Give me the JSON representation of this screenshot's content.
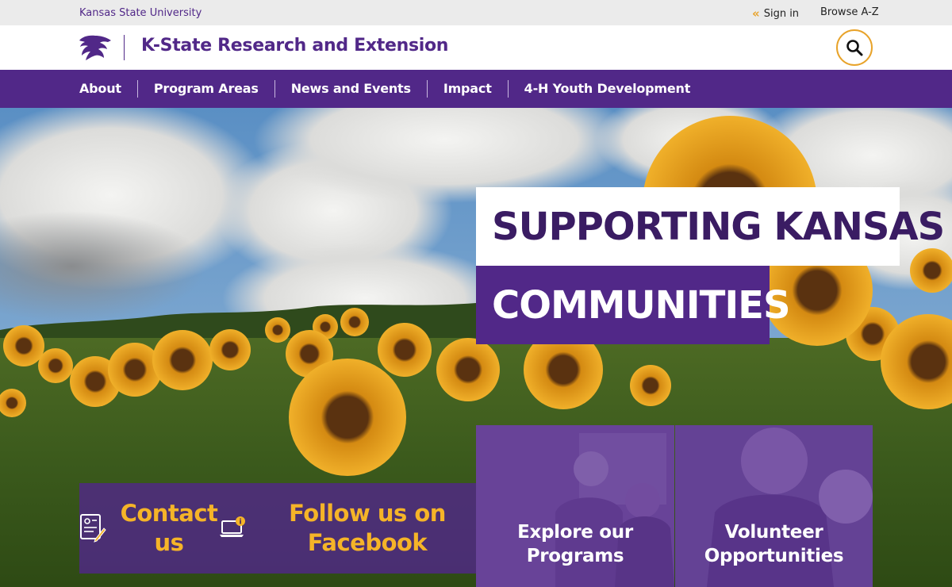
{
  "utility": {
    "university": "Kansas State University",
    "sign_in": "Sign in",
    "browse": "Browse A-Z"
  },
  "header": {
    "title": "K-State Research and Extension"
  },
  "nav": {
    "items": [
      {
        "label": "About"
      },
      {
        "label": "Program Areas"
      },
      {
        "label": "News and Events"
      },
      {
        "label": "Impact"
      },
      {
        "label": "4-H Youth Development"
      }
    ]
  },
  "hero": {
    "headline_line1": "SUPPORTING KANSAS",
    "headline_line2": "COMMUNITIES"
  },
  "cta": {
    "contact_line1": "Contact",
    "contact_line2": "us",
    "follow_line1": "Follow us on",
    "follow_line2": "Facebook"
  },
  "tiles": {
    "explore_line1": "Explore our",
    "explore_line2": "Programs",
    "volunteer_line1": "Volunteer",
    "volunteer_line2": "Opportunities"
  },
  "colors": {
    "purple": "#512888",
    "dark_purple": "#3a1c63",
    "gold": "#f5b428",
    "utility_bg": "#ebebeb"
  },
  "icons": [
    "chevrons-left-icon",
    "powercat-logo",
    "search-icon",
    "contact-form-icon",
    "laptop-info-icon"
  ]
}
